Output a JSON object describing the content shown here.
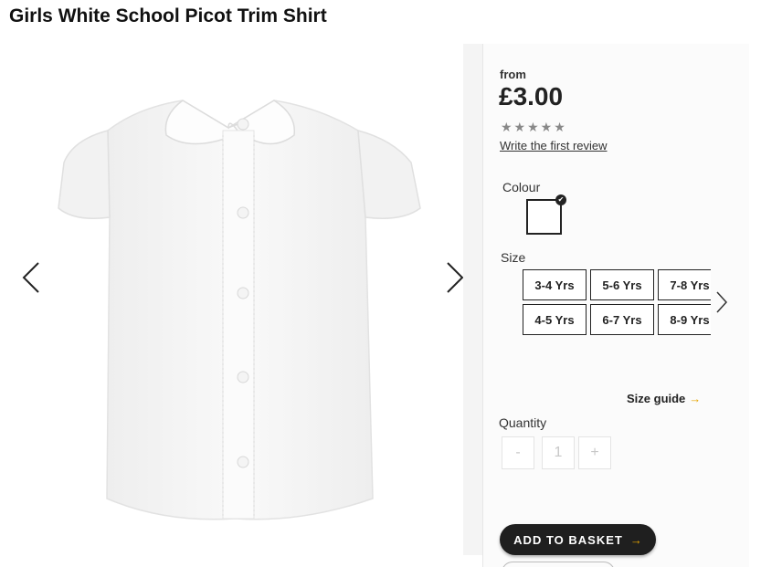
{
  "product": {
    "title": "Girls White School Picot Trim Shirt",
    "price_prefix": "from",
    "price": "£3.00",
    "rating_stars": "★★★★★",
    "rating_value": 0,
    "review_link": "Write the first review"
  },
  "gallery": {
    "prev_icon": "chevron-left-icon",
    "next_icon": "chevron-right-icon"
  },
  "colour": {
    "label": "Colour",
    "selected_swatch": "#ffffff",
    "check_icon": "✔"
  },
  "size": {
    "label": "Size",
    "options": [
      "3-4 Yrs",
      "5-6 Yrs",
      "7-8 Yrs",
      "4-5 Yrs",
      "6-7 Yrs",
      "8-9 Yrs"
    ],
    "next_icon": "chevron-right-icon",
    "guide_label": "Size guide",
    "guide_arrow": "→"
  },
  "quantity": {
    "label": "Quantity",
    "minus": "-",
    "value": "1",
    "plus": "+"
  },
  "basket": {
    "label": "ADD TO BASKET",
    "arrow": "→"
  },
  "colors": {
    "accent": "#e6a400",
    "button_dark": "#1f1f1f"
  }
}
